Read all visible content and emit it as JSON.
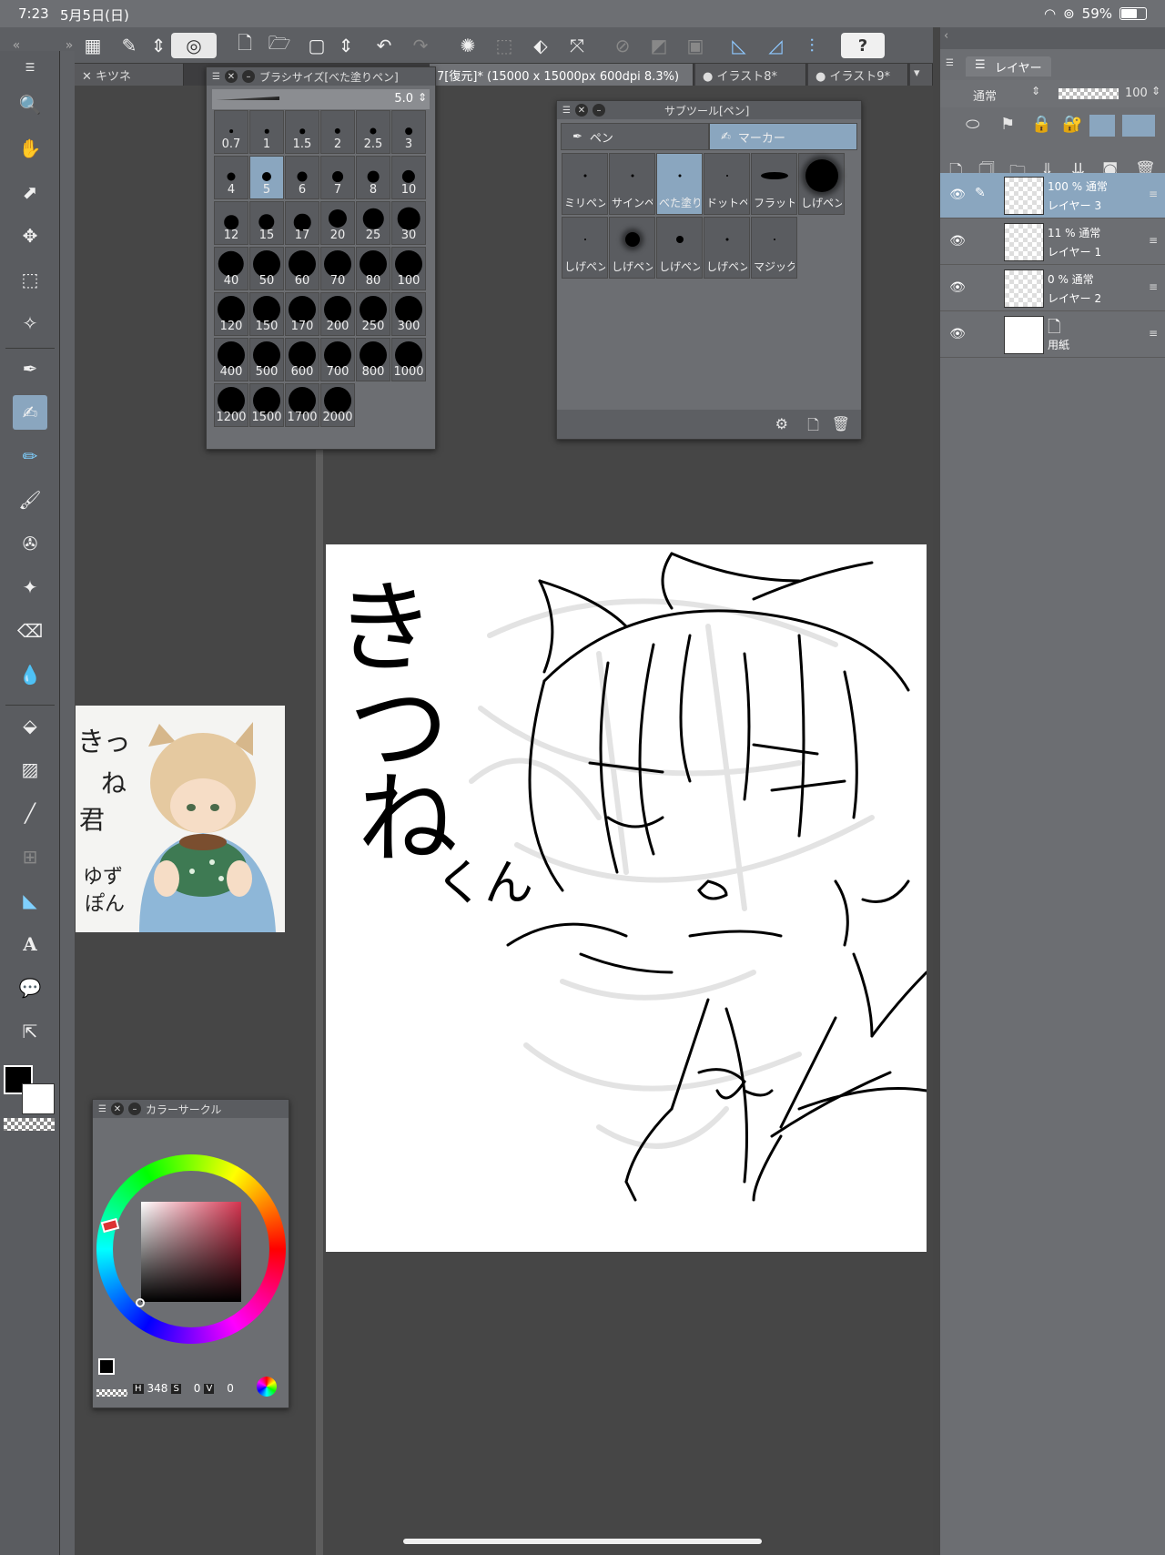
{
  "status": {
    "time": "7:23",
    "date": "5月5日(日)",
    "battery": "59%",
    "battery_level": 0.59
  },
  "tabs": [
    {
      "label": "キツネ",
      "active": false
    },
    {
      "label": "7[復元]* (15000 x 15000px 600dpi 8.3%)",
      "active": true
    },
    {
      "label": "イラスト8*",
      "active": false
    },
    {
      "label": "イラスト9*",
      "active": false
    }
  ],
  "brush_panel": {
    "title": "ブラシサイズ[べた塗りペン]",
    "value": "5.0",
    "sizes": [
      "0.7",
      "1",
      "1.5",
      "2",
      "2.5",
      "3",
      "4",
      "5",
      "6",
      "7",
      "8",
      "10",
      "12",
      "15",
      "17",
      "20",
      "25",
      "30",
      "40",
      "50",
      "60",
      "70",
      "80",
      "100",
      "120",
      "150",
      "170",
      "200",
      "250",
      "300",
      "400",
      "500",
      "600",
      "700",
      "800",
      "1000",
      "1200",
      "1500",
      "1700",
      "2000"
    ],
    "selected": "5"
  },
  "subtool_panel": {
    "title": "サブツール[ペン]",
    "tabs": [
      "ペン",
      "マーカー"
    ],
    "active_tab": "マーカー",
    "items": [
      "ミリペン",
      "サインペン",
      "べた塗りペン",
      "ドットペン",
      "フラットペン",
      "しげペン",
      "しげペン",
      "しげペン",
      "しげペン",
      "しげペン",
      "マジック"
    ],
    "selected": 2
  },
  "color_panel": {
    "title": "カラーサークル",
    "h_label": "H",
    "h_value": "348",
    "s_label": "S",
    "s_value": "0",
    "v_label": "V",
    "v_value": "0",
    "hue_color": "#d4344f"
  },
  "layer_panel": {
    "tab_label": "レイヤー",
    "blend_mode": "通常",
    "opacity": "100",
    "layers": [
      {
        "opacity_mode": "100 % 通常",
        "name": "レイヤー 3",
        "selected": true,
        "type": "raster"
      },
      {
        "opacity_mode": "11 % 通常",
        "name": "レイヤー 1",
        "selected": false,
        "type": "raster"
      },
      {
        "opacity_mode": "0 % 通常",
        "name": "レイヤー 2",
        "selected": false,
        "type": "raster"
      },
      {
        "opacity_mode": "",
        "name": "用紙",
        "selected": false,
        "type": "paper"
      }
    ]
  },
  "reference_image": {
    "text_lines": [
      "きっ",
      "ね",
      "君",
      "ゆず",
      "ぽん"
    ]
  },
  "canvas_text": [
    "き",
    "つ",
    "ね",
    "くん"
  ],
  "colors": {
    "accent": "#8aa6bf",
    "panel": "#6c6e72",
    "toolbar": "#5d5f63"
  }
}
